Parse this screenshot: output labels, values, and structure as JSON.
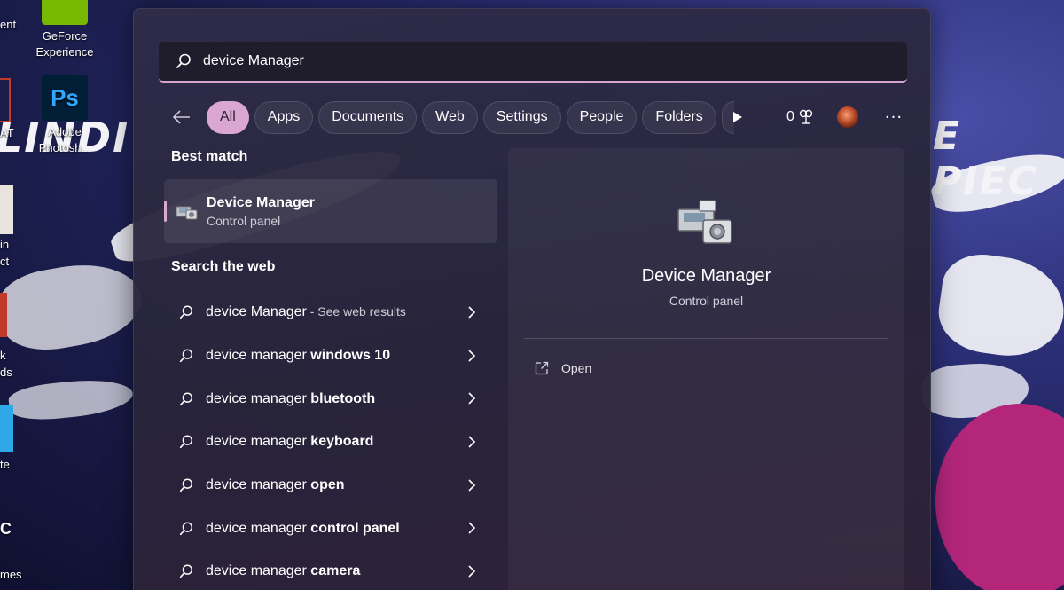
{
  "desktop": {
    "icons": [
      {
        "label_line1": "GeForce",
        "label_line2": "Experience",
        "color": "#76b900"
      },
      {
        "label_line1": "Adobe",
        "label_line2": "Photosh...",
        "color": "#001e36",
        "glyph": "Ps"
      }
    ],
    "edge_labels": [
      "ent",
      "AT",
      "in",
      "ct",
      "k",
      "ds",
      "te",
      "C",
      "mes"
    ],
    "bg_text_left": "LINDI",
    "bg_text_right": "E PIEC"
  },
  "search": {
    "value": "device Manager",
    "icon": "search-icon"
  },
  "filters": {
    "back_icon": "back-arrow-icon",
    "tabs": [
      "All",
      "Apps",
      "Documents",
      "Web",
      "Settings",
      "People",
      "Folders"
    ],
    "active": "All",
    "points": "0",
    "more": "···"
  },
  "best_match": {
    "heading": "Best match",
    "title": "Device Manager",
    "subtitle": "Control panel"
  },
  "web": {
    "heading": "Search the web",
    "items": [
      {
        "prefix": "device Manager",
        "bold": "",
        "hint": " - See web results"
      },
      {
        "prefix": "device manager ",
        "bold": "windows 10",
        "hint": ""
      },
      {
        "prefix": "device manager ",
        "bold": "bluetooth",
        "hint": ""
      },
      {
        "prefix": "device manager ",
        "bold": "keyboard",
        "hint": ""
      },
      {
        "prefix": "device manager ",
        "bold": "open",
        "hint": ""
      },
      {
        "prefix": "device manager ",
        "bold": "control panel",
        "hint": ""
      },
      {
        "prefix": "device manager ",
        "bold": "camera",
        "hint": ""
      }
    ]
  },
  "preview": {
    "title": "Device Manager",
    "subtitle": "Control panel",
    "action_label": "Open",
    "action_icon": "open-external-icon"
  },
  "colors": {
    "accent": "#d9a7d1",
    "panel": "#2e2c48"
  }
}
